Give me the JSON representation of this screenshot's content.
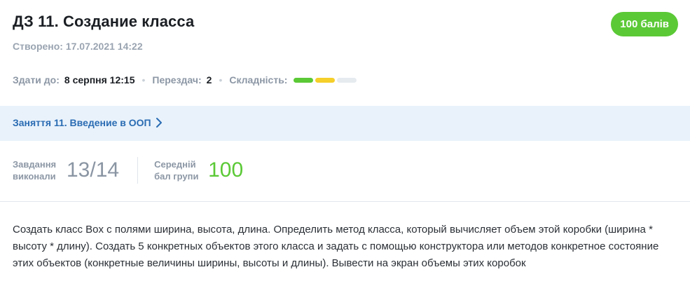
{
  "header": {
    "title": "ДЗ 11. Создание класса",
    "created": "Створено: 17.07.2021 14:22",
    "score_badge": "100 балів"
  },
  "meta": {
    "deadline_label": "Здати до:",
    "deadline_value": "8 серпня 12:15",
    "resubmits_label": "Перездач:",
    "resubmits_value": "2",
    "difficulty_label": "Складність:",
    "difficulty_level": 2,
    "difficulty_max": 3,
    "difficulty_colors": [
      "#5bc936",
      "#f5cf2a",
      "#e6ebf0"
    ]
  },
  "lesson": {
    "link_text": "Заняття 11. Введение в ООП",
    "icon": "chevron-right-icon"
  },
  "stats": {
    "tasks_label_line1": "Завдання",
    "tasks_label_line2": "виконали",
    "tasks_value": "13/14",
    "avg_label_line1": "Середній",
    "avg_label_line2": "бал групи",
    "avg_value": "100"
  },
  "description": "Создать класс Box с полями ширина, высота, длина. Определить метод класса, который вычисляет объем этой коробки (ширина * высоту * длину). Создать 5 конкретных объектов этого класса и задать с помощью конструктора или методов конкретное состояние этих объектов (конкретные величины ширины, высоты и длины). Вывести на экран объемы этих коробок",
  "colors": {
    "accent_green": "#5bc936",
    "link_blue": "#2a6cb3",
    "lesson_bar_bg": "#e9f2fb"
  }
}
